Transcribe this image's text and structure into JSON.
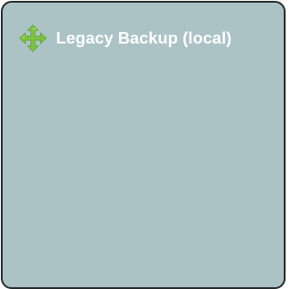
{
  "panel": {
    "title": "Legacy Backup (local)",
    "icon": "move-arrows-icon",
    "colors": {
      "background": "#acc3c6",
      "border": "#242a2b",
      "icon_fill": "#7cc242",
      "title_text": "#ffffff"
    }
  }
}
